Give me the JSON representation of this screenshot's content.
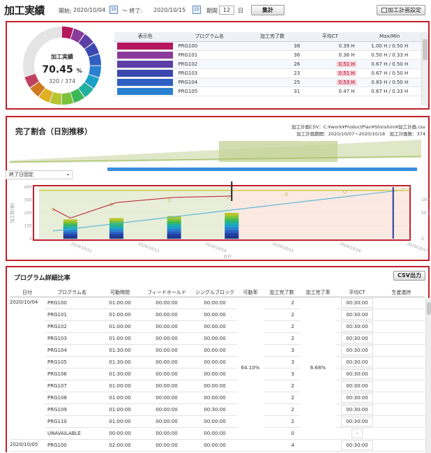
{
  "toolbar": {
    "title": "加工実績",
    "start_label": "開始:",
    "start_value": "2020/10/04",
    "end_label": "～ 終了:",
    "end_value": "2020/10/15",
    "calendar_icon_text": "15",
    "period_label": "期間",
    "period_value": "12",
    "period_unit": "日",
    "aggregate_button": "集計",
    "plan_settings_button": "加工計画設定"
  },
  "summary": {
    "donut_title": "加工実績",
    "percent_value": "70.45",
    "percent_unit": "%",
    "ratio": "320 / 374",
    "donut_completion": 0.7045,
    "columns": [
      "表示色",
      "プログラム名",
      "加工完了数",
      "平均CT",
      "Max/Min"
    ],
    "rows": [
      {
        "color": "#b5175e",
        "program": "PRG100",
        "count": "38",
        "avg_ct": "0.39 H",
        "highlight": false,
        "maxmin": "1.00 H / 0.50 H"
      },
      {
        "color": "#8a3a9a",
        "program": "PRG101",
        "count": "36",
        "avg_ct": "0.36 H",
        "highlight": false,
        "maxmin": "0.50 H / 0.33 H"
      },
      {
        "color": "#5b3ea6",
        "program": "PRG102",
        "count": "26",
        "avg_ct": "0.51 H",
        "highlight": true,
        "maxmin": "0.67 H / 0.50 H"
      },
      {
        "color": "#3a48b0",
        "program": "PRG103",
        "count": "23",
        "avg_ct": "0.51 H",
        "highlight": true,
        "maxmin": "0.67 H / 0.50 H"
      },
      {
        "color": "#2f5fc0",
        "program": "PRG104",
        "count": "25",
        "avg_ct": "0.53 H",
        "highlight": true,
        "maxmin": "0.83 H / 0.50 H"
      },
      {
        "color": "#2a80d0",
        "program": "PRG105",
        "count": "31",
        "avg_ct": "0.47 H",
        "highlight": false,
        "maxmin": "0.67 H / 0.33 H"
      }
    ]
  },
  "trend": {
    "title": "完了割合（日別推移）",
    "csv_info": "加工計画CSV：C:¥work¥ProductPlan¥Shinshiro¥加工計画.csv",
    "plan_info": "加工計画期間：2020/10/07～2020/10/18　加工計画数：374",
    "dropdown_value": "終了日固定",
    "y_left_label": "加工数(個)",
    "y_right_label": "(%)",
    "x_label": "日付"
  },
  "chart_data": {
    "type": "bar",
    "categories": [
      "2020/10/12",
      "2020/10/13",
      "2020/10/14",
      "2020/10/15",
      "2020/10/16",
      "2020/10/17"
    ],
    "y_ticks_left": [
      "400",
      "300",
      "200",
      "100",
      "0"
    ],
    "y_ticks_right": [
      "100",
      "50",
      "0"
    ],
    "ylim": [
      0,
      400
    ],
    "bars_x": [
      0.1,
      1.1,
      2.1
    ],
    "bars_values": [
      150,
      160,
      175,
      200
    ],
    "bar_positions": [
      -0.3,
      0.5,
      1.5,
      2.5
    ],
    "plan_line": [
      {
        "x": -0.6,
        "y": 60
      },
      {
        "x": 5.4,
        "y": 374
      }
    ],
    "actual_line": [
      {
        "x": -0.6,
        "y": 230
      },
      {
        "x": -0.3,
        "y": 160
      },
      {
        "x": 0.5,
        "y": 280
      },
      {
        "x": 1.5,
        "y": 320
      },
      {
        "x": 2.5,
        "y": 330
      }
    ],
    "target_line": 374,
    "percent_points": [
      60,
      70,
      79,
      85,
      91,
      96,
      100
    ],
    "current_marker": 2.5,
    "end_marker": 5.3
  },
  "detail": {
    "title": "プログラム詳細比率",
    "csv_button": "CSV出力",
    "columns": [
      "日付",
      "プログラム名",
      "可動時間",
      "フィードホールド",
      "シングルブロック",
      "可動率",
      "加工完了数",
      "加工完了率",
      "平均CT",
      "生産進捗"
    ],
    "date1": "2020/10/04",
    "date2": "2020/10/05",
    "rate1": "64.10%",
    "completion_rate1": "6.68%",
    "rows": [
      {
        "program": "PRG100",
        "uptime": "01:00:00",
        "feedhold": "00:00:00",
        "single": "00:00:00",
        "count": "2",
        "ct": "00:30:00"
      },
      {
        "program": "PRG101",
        "uptime": "01:00:00",
        "feedhold": "00:00:00",
        "single": "00:00:00",
        "count": "2",
        "ct": "00:30:00"
      },
      {
        "program": "PRG102",
        "uptime": "01:00:00",
        "feedhold": "00:00:00",
        "single": "00:00:00",
        "count": "2",
        "ct": "00:30:00"
      },
      {
        "program": "PRG103",
        "uptime": "01:00:00",
        "feedhold": "00:00:00",
        "single": "00:00:00",
        "count": "2",
        "ct": "00:30:00"
      },
      {
        "program": "PRG104",
        "uptime": "01:30:00",
        "feedhold": "00:00:00",
        "single": "00:00:00",
        "count": "3",
        "ct": "00:30:00"
      },
      {
        "program": "PRG105",
        "uptime": "01:30:00",
        "feedhold": "00:00:00",
        "single": "00:00:00",
        "count": "3",
        "ct": "00:30:00"
      },
      {
        "program": "PRG106",
        "uptime": "01:30:00",
        "feedhold": "00:00:00",
        "single": "00:00:00",
        "count": "3",
        "ct": "00:30:00"
      },
      {
        "program": "PRG107",
        "uptime": "01:00:00",
        "feedhold": "00:00:00",
        "single": "00:00:00",
        "count": "2",
        "ct": "00:30:00"
      },
      {
        "program": "PRG108",
        "uptime": "01:00:00",
        "feedhold": "00:00:00",
        "single": "00:00:00",
        "count": "2",
        "ct": "00:30:00"
      },
      {
        "program": "PRG109",
        "uptime": "01:00:00",
        "feedhold": "00:00:00",
        "single": "00:30:00",
        "count": "2",
        "ct": "00:30:00"
      },
      {
        "program": "PRG110",
        "uptime": "01:00:00",
        "feedhold": "00:00:00",
        "single": "00:00:00",
        "count": "2",
        "ct": "00:30:00"
      },
      {
        "program": "UNAVAILABLE",
        "uptime": "00:00:00",
        "feedhold": "00:00:00",
        "single": "00:00:00",
        "count": "0",
        "ct": "-"
      },
      {
        "program": "PRG100",
        "uptime": "02:00:00",
        "feedhold": "00:00:00",
        "single": "00:00:00",
        "count": "4",
        "ct": "00:30:00"
      }
    ]
  }
}
